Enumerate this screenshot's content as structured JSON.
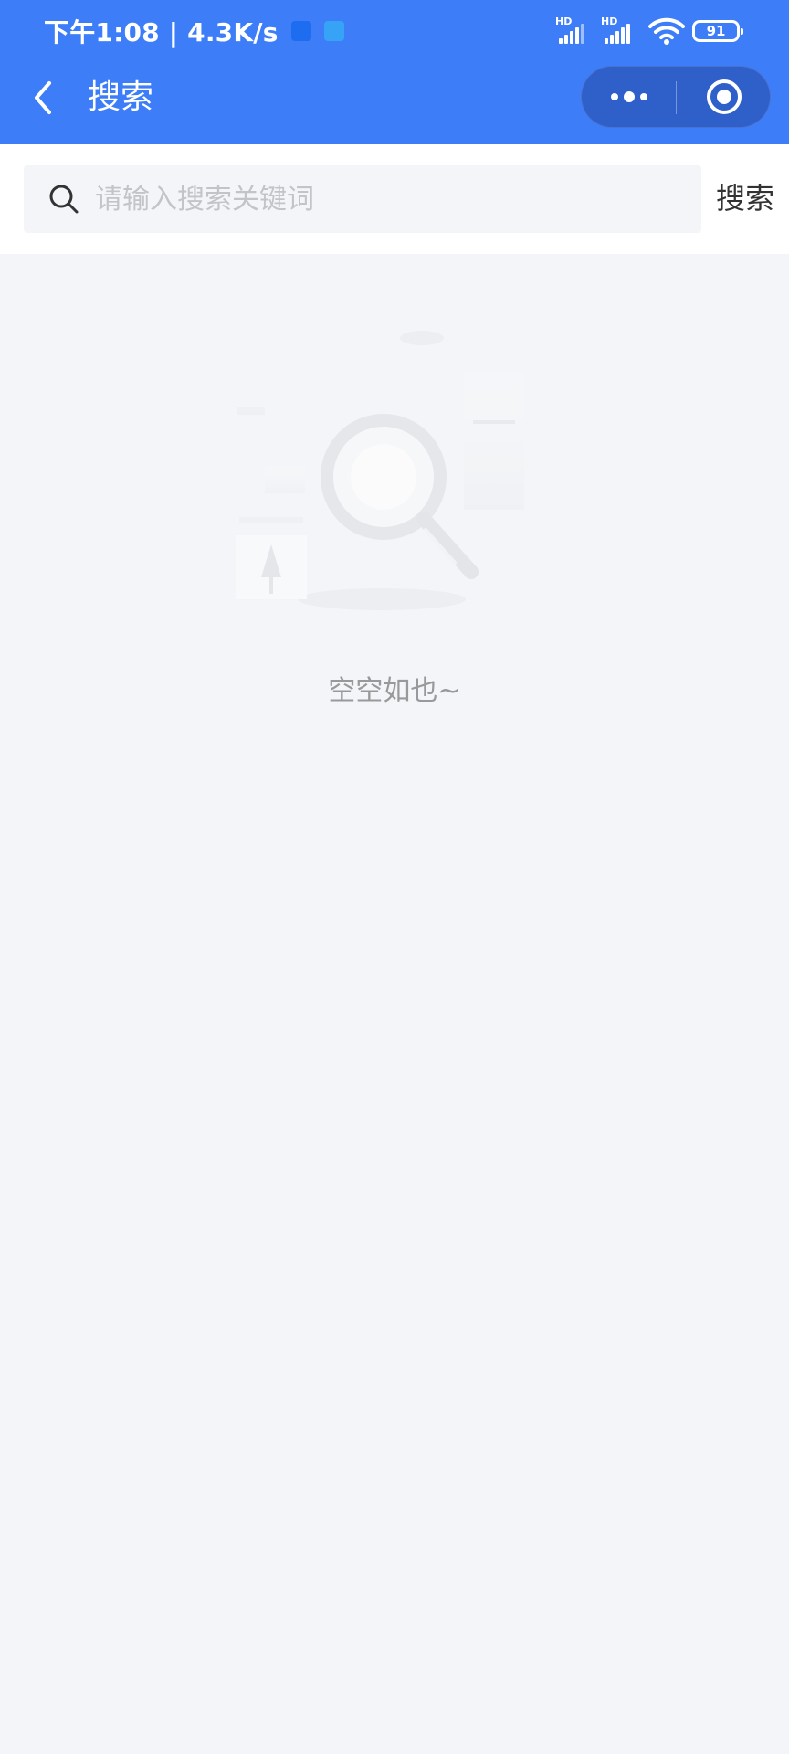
{
  "status_bar": {
    "time_speed": "下午1:08 | 4.3K/s",
    "hd_label": "HD",
    "battery": "91",
    "app_icon_colors": [
      "#1e6cf0",
      "#36a3f7"
    ]
  },
  "navbar": {
    "title": "搜索",
    "background": "#3d7ef8"
  },
  "search": {
    "placeholder": "请输入搜索关键词",
    "value": "",
    "button_label": "搜索"
  },
  "empty_state": {
    "message": "空空如也~"
  }
}
